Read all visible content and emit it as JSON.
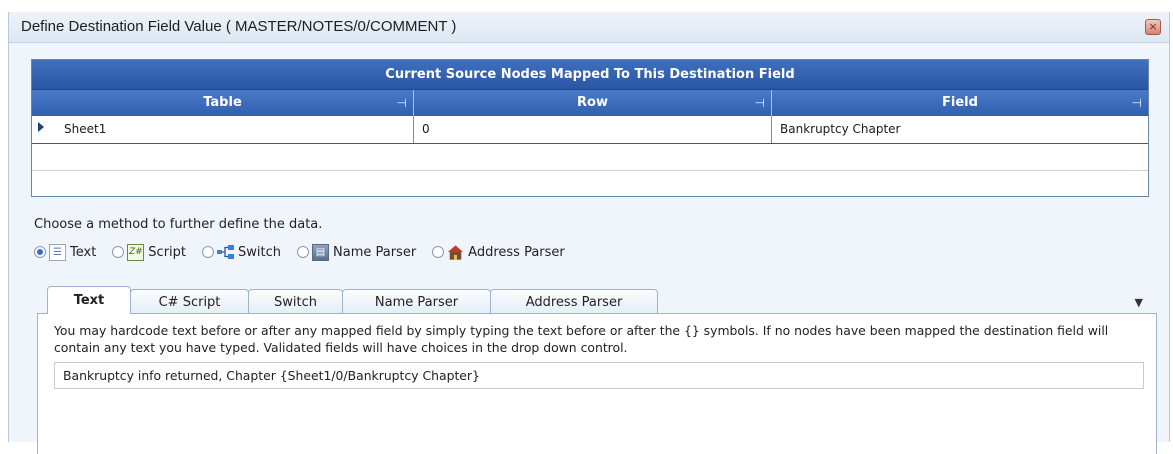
{
  "window": {
    "title": "Define Destination Field Value ( MASTER/NOTES/0/COMMENT )",
    "close_icon": "×"
  },
  "grid": {
    "caption": "Current Source Nodes Mapped To This Destination Field",
    "columns": [
      {
        "label": "Table",
        "pin_icon": "⊣"
      },
      {
        "label": "Row",
        "pin_icon": "⊣"
      },
      {
        "label": "Field",
        "pin_icon": "⊣"
      }
    ],
    "rows": [
      {
        "table": "Sheet1",
        "row": "0",
        "field": "Bankruptcy Chapter"
      }
    ],
    "header_color": "#2f5fae"
  },
  "methods": {
    "prompt": "Choose a method to further define the data.",
    "selected": "Text",
    "options": [
      {
        "label": "Text",
        "icon": "text-icon"
      },
      {
        "label": "Script",
        "icon": "csharp-script-icon"
      },
      {
        "label": "Switch",
        "icon": "switch-icon"
      },
      {
        "label": "Name Parser",
        "icon": "name-parser-icon"
      },
      {
        "label": "Address Parser",
        "icon": "house-icon"
      }
    ]
  },
  "tabs": [
    {
      "label": "Text",
      "active": true
    },
    {
      "label": "C# Script",
      "active": false
    },
    {
      "label": "Switch",
      "active": false
    },
    {
      "label": "Name Parser",
      "active": false
    },
    {
      "label": "Address Parser",
      "active": false
    }
  ],
  "text_tab": {
    "help_text": "You may hardcode text before or after any mapped field by simply typing the text before or after the {} symbols.  If no nodes have been mapped the destination field will contain any text you have typed. Validated fields will have choices in the drop down control.",
    "value": "Bankruptcy info returned, Chapter {Sheet1/0/Bankruptcy Chapter}"
  }
}
